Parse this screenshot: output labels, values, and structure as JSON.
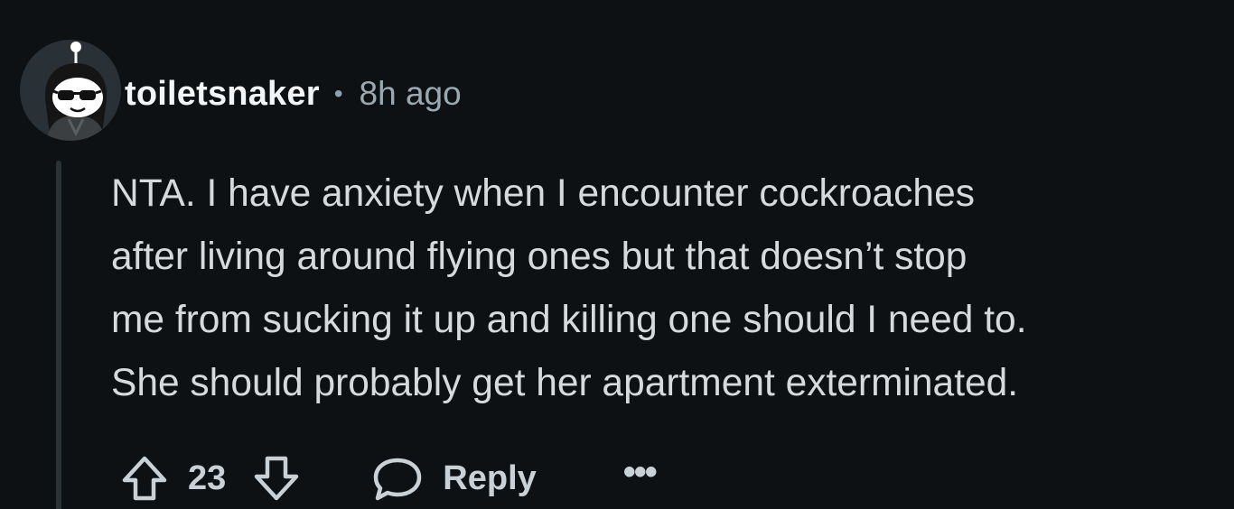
{
  "comment": {
    "author": "toiletsnaker",
    "separator": "•",
    "time_ago": "8h ago",
    "body_lines": [
      "NTA. I have anxiety when I encounter cockroaches",
      "after living around flying ones but that doesn’t stop",
      "me from sucking it up and killing one should I need to.",
      "She should probably get her apartment exterminated."
    ],
    "vote_count": "23",
    "reply_label": "Reply",
    "more_label": "•••"
  },
  "icons": {
    "avatar": "snoo-avatar-with-sunglasses",
    "upvote": "arrow-up-outline-icon",
    "downvote": "arrow-down-outline-icon",
    "reply": "speech-bubble-icon",
    "more": "ellipsis-icon"
  },
  "colors": {
    "background": "#0e1113",
    "text_primary": "#f2f4f5",
    "text_body": "#d7dadc",
    "text_muted": "#9aa9b1",
    "avatar_bg": "#2a3136",
    "thread_line": "#2a3236"
  }
}
